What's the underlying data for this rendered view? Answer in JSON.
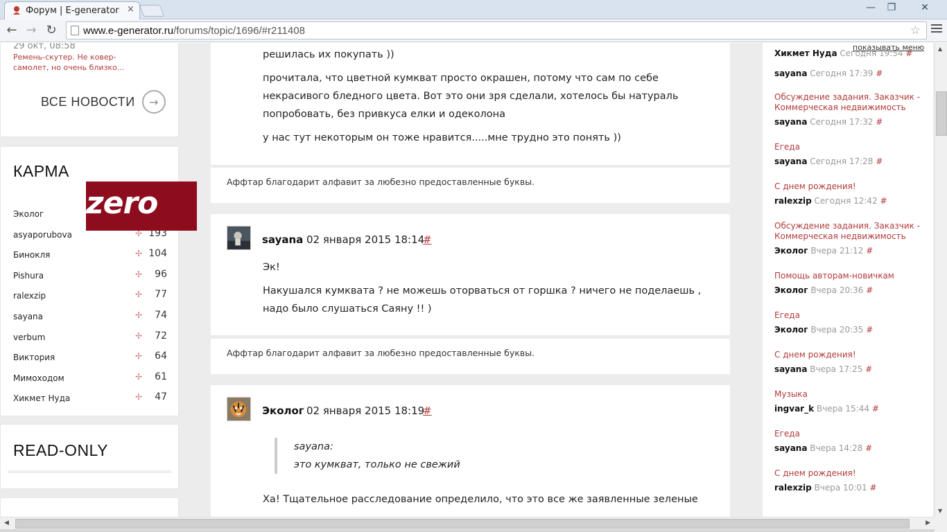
{
  "browser": {
    "tab_title": "Форум | E-generator",
    "tab_close": "×",
    "url_host": "www.e-generator.ru",
    "url_path": "/forums/topic/1696/#r211408",
    "win_min": "—",
    "win_max": "❐",
    "win_close": "✕"
  },
  "sidebar": {
    "news": {
      "date": "29 окт, 08:58",
      "text": "Ремень-скутер. Не ковер-самолет, но очень близко...",
      "all_news_label": "ВСЕ НОВОСТИ"
    },
    "karma": {
      "title": "КАРМА",
      "rows": [
        {
          "name": "Эколог",
          "value": ""
        },
        {
          "name": "asyaporubova",
          "value": "193"
        },
        {
          "name": "Бинокля",
          "value": "104"
        },
        {
          "name": "Pishura",
          "value": "96"
        },
        {
          "name": "ralexzip",
          "value": "77"
        },
        {
          "name": "sayana",
          "value": "74"
        },
        {
          "name": "verbum",
          "value": "72"
        },
        {
          "name": "Виктория",
          "value": "64"
        },
        {
          "name": "Мимоходом",
          "value": "61"
        },
        {
          "name": "Хикмет Нуда",
          "value": "47"
        }
      ]
    },
    "zero_badge": "zero",
    "readonly_title": "READ-ONLY"
  },
  "posts": {
    "p0": {
      "lines": [
        "решилась их покупать ))",
        "прочитала, что цветной кумкват просто окрашен, потому что сам по себе некрасивого бледного цвета. Вот это они зря сделали, хотелось бы натураль попробовать, без привкуса елки и одеколона",
        "у нас тут некоторым он тоже нравится.....мне трудно это понять ))"
      ],
      "signature": "Аффтар благодарит алфавит за любезно предоставленные буквы."
    },
    "p1": {
      "author": "sayana",
      "date": "02 января 2015 18:14",
      "hash": "#",
      "lines": [
        "Эк!",
        "Накушался кумквата ? не можешь оторваться от горшка ? ничего не поделаешь , надо было слушаться Саяну !! )"
      ],
      "signature": "Аффтар благодарит алфавит за любезно предоставленные буквы."
    },
    "p2": {
      "author": "Эколог",
      "date": "02 января 2015 18:19",
      "hash": "#",
      "quote_author": "sayana:",
      "quote_text": "это кумкват, только не свежий",
      "lines": [
        "Ха! Тщательное расследование определило, что это все же заявленные зеленые"
      ]
    }
  },
  "right": {
    "show_menu": "показывать меню",
    "items": [
      {
        "topic": "",
        "user": "Хикмет Нуда",
        "time": "Сегодня 19:54",
        "hash": "#"
      },
      {
        "topic": "",
        "user": "sayana",
        "time": "Сегодня 17:39",
        "hash": "#"
      },
      {
        "topic": "Обсуждение задания. Заказчик - Коммерческая недвижимость",
        "user": "sayana",
        "time": "Сегодня 17:32",
        "hash": "#"
      },
      {
        "topic": "Егеда",
        "user": "sayana",
        "time": "Сегодня 17:28",
        "hash": "#"
      },
      {
        "topic": "С днем рождения!",
        "user": "ralexzip",
        "time": "Сегодня 12:42",
        "hash": "#"
      },
      {
        "topic": "Обсуждение задания. Заказчик - Коммерческая недвижимость",
        "user": "Эколог",
        "time": "Вчера 21:12",
        "hash": "#"
      },
      {
        "topic": "Помощь авторам-новичкам",
        "user": "Эколог",
        "time": "Вчера 20:36",
        "hash": "#"
      },
      {
        "topic": "Егеда",
        "user": "Эколог",
        "time": "Вчера 20:35",
        "hash": "#"
      },
      {
        "topic": "С днем рождения!",
        "user": "sayana",
        "time": "Вчера 17:25",
        "hash": "#"
      },
      {
        "topic": "Музыка",
        "user": "ingvar_k",
        "time": "Вчера 15:44",
        "hash": "#"
      },
      {
        "topic": "Егеда",
        "user": "sayana",
        "time": "Вчера 14:28",
        "hash": "#"
      },
      {
        "topic": "С днем рождения!",
        "user": "ralexzip",
        "time": "Вчера 10:01",
        "hash": "#"
      }
    ]
  }
}
